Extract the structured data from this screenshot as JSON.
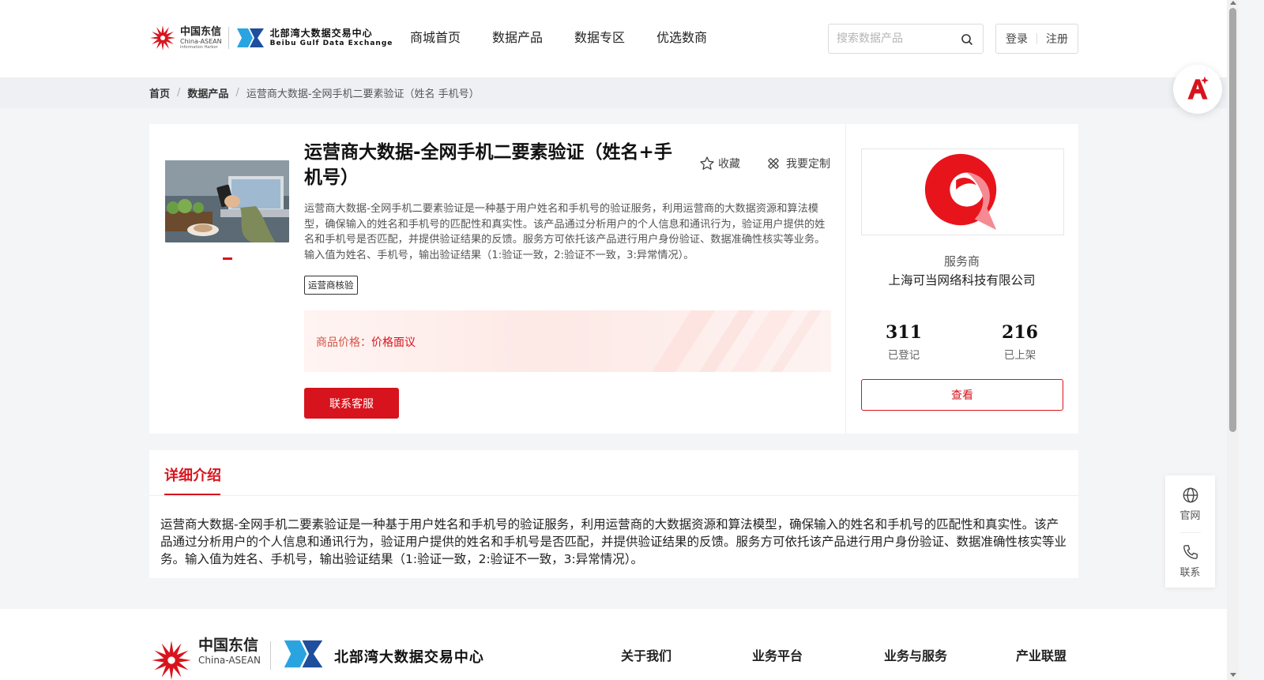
{
  "header": {
    "logo": {
      "cn_name": "中国东信",
      "cn_sub": "China-ASEAN",
      "cn_sub2": "Information Harbor",
      "exchange_cn": "北部湾大数据交易中心",
      "exchange_en": "Beibu Gulf Data Exchange"
    },
    "nav": [
      "商城首页",
      "数据产品",
      "数据专区",
      "优选数商"
    ],
    "search": {
      "placeholder": "搜索数据产品"
    },
    "auth": {
      "login": "登录",
      "register": "注册"
    }
  },
  "breadcrumb": {
    "items": [
      "首页",
      "数据产品"
    ],
    "current": "运营商大数据-全网手机二要素验证（姓名 手机号）",
    "separator": "/"
  },
  "product": {
    "title": "运营商大数据-全网手机二要素验证（姓名+手机号）",
    "favorite_label": "收藏",
    "customize_label": "我要定制",
    "description": "运营商大数据-全网手机二要素验证是一种基于用户姓名和手机号的验证服务，利用运营商的大数据资源和算法模型，确保输入的姓名和手机号的匹配性和真实性。该产品通过分析用户的个人信息和通讯行为，验证用户提供的姓名和手机号是否匹配，并提供验证结果的反馈。服务方可依托该产品进行用户身份验证、数据准确性核实等业务。输入值为姓名、手机号，输出验证结果（1:验证一致，2:验证不一致，3:异常情况）。",
    "tag": "运营商核验",
    "price_label": "商品价格：",
    "price_value": "价格面议",
    "contact_button": "联系客服"
  },
  "provider": {
    "label": "服务商",
    "name": "上海可当网络科技有限公司",
    "stats": [
      {
        "value": "311",
        "label": "已登记"
      },
      {
        "value": "216",
        "label": "已上架"
      }
    ],
    "view_button": "查看"
  },
  "detail": {
    "tab": "详细介绍",
    "text": "运营商大数据-全网手机二要素验证是一种基于用户姓名和手机号的验证服务，利用运营商的大数据资源和算法模型，确保输入的姓名和手机号的匹配性和真实性。该产品通过分析用户的个人信息和通讯行为，验证用户提供的姓名和手机号是否匹配，并提供验证结果的反馈。服务方可依托该产品进行用户身份验证、数据准确性核实等业务。输入值为姓名、手机号，输出验证结果（1:验证一致，2:验证不一致，3:异常情况）。"
  },
  "side_panel": {
    "items": [
      {
        "label": "官网",
        "icon": "globe-icon"
      },
      {
        "label": "联系",
        "icon": "phone-icon"
      }
    ]
  },
  "footer": {
    "cn_name": "中国东信",
    "cn_sub": "China-ASEAN",
    "exchange_cn": "北部湾大数据交易中心",
    "links": [
      "关于我们",
      "业务平台",
      "业务与服务",
      "产业联盟"
    ]
  },
  "colors": {
    "brand_red": "#d7141d",
    "price_red": "#d35548",
    "breadcrumb_bg": "#eef0f4",
    "page_bg": "#f4f5f7"
  }
}
